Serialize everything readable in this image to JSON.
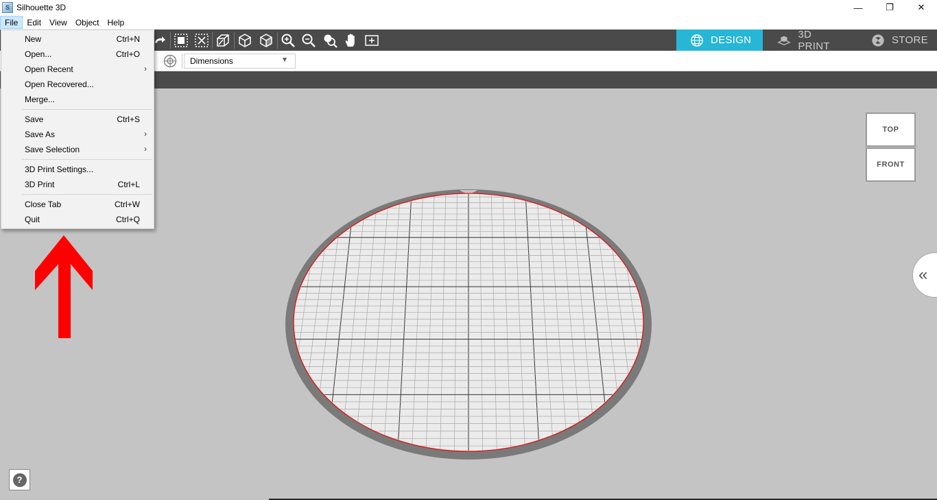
{
  "window": {
    "title": "Silhouette 3D",
    "icon_letter": "S",
    "minimize_glyph": "—",
    "restore_glyph": "❐",
    "close_glyph": "✕"
  },
  "menubar": {
    "items": [
      "File",
      "Edit",
      "View",
      "Object",
      "Help"
    ]
  },
  "tabs": {
    "design": "DESIGN",
    "print": "3D PRINT",
    "store": "STORE",
    "active_color": "#27b6d6"
  },
  "toolbar": {
    "icons": [
      "redo-icon",
      "group-icon",
      "ungroup-icon",
      "extrude-icon",
      "cube-icon",
      "cube-outline-icon",
      "zoom-in-icon",
      "zoom-out-icon",
      "zoom-selection-icon",
      "pan-hand-icon",
      "fit-view-icon"
    ]
  },
  "subbar": {
    "dimensions_label": "Dimensions",
    "arrow_glyph": "▼"
  },
  "viewcube": {
    "top": "TOP",
    "front": "FRONT"
  },
  "side_toggle_glyph": "«",
  "help_glyph": "?",
  "file_menu": {
    "groups": [
      [
        {
          "label": "New",
          "shortcut": "Ctrl+N"
        },
        {
          "label": "Open...",
          "shortcut": "Ctrl+O"
        },
        {
          "label": "Open Recent",
          "submenu": true
        },
        {
          "label": "Open Recovered..."
        },
        {
          "label": "Merge..."
        }
      ],
      [
        {
          "label": "Save",
          "shortcut": "Ctrl+S"
        },
        {
          "label": "Save As",
          "submenu": true
        },
        {
          "label": "Save Selection",
          "submenu": true
        }
      ],
      [
        {
          "label": "3D Print Settings..."
        },
        {
          "label": "3D Print",
          "shortcut": "Ctrl+L"
        }
      ],
      [
        {
          "label": "Close Tab",
          "shortcut": "Ctrl+W"
        },
        {
          "label": "Quit",
          "shortcut": "Ctrl+Q"
        }
      ]
    ],
    "submenu_glyph": "›"
  },
  "colors": {
    "toolbar_bg": "#4a4a4a",
    "viewport_bg": "#c4c4c4",
    "bed_rim": "#7a7a7a",
    "bed_surface": "#ebebeb",
    "bed_edge": "#e01010",
    "annotation_arrow": "#ff0000"
  }
}
